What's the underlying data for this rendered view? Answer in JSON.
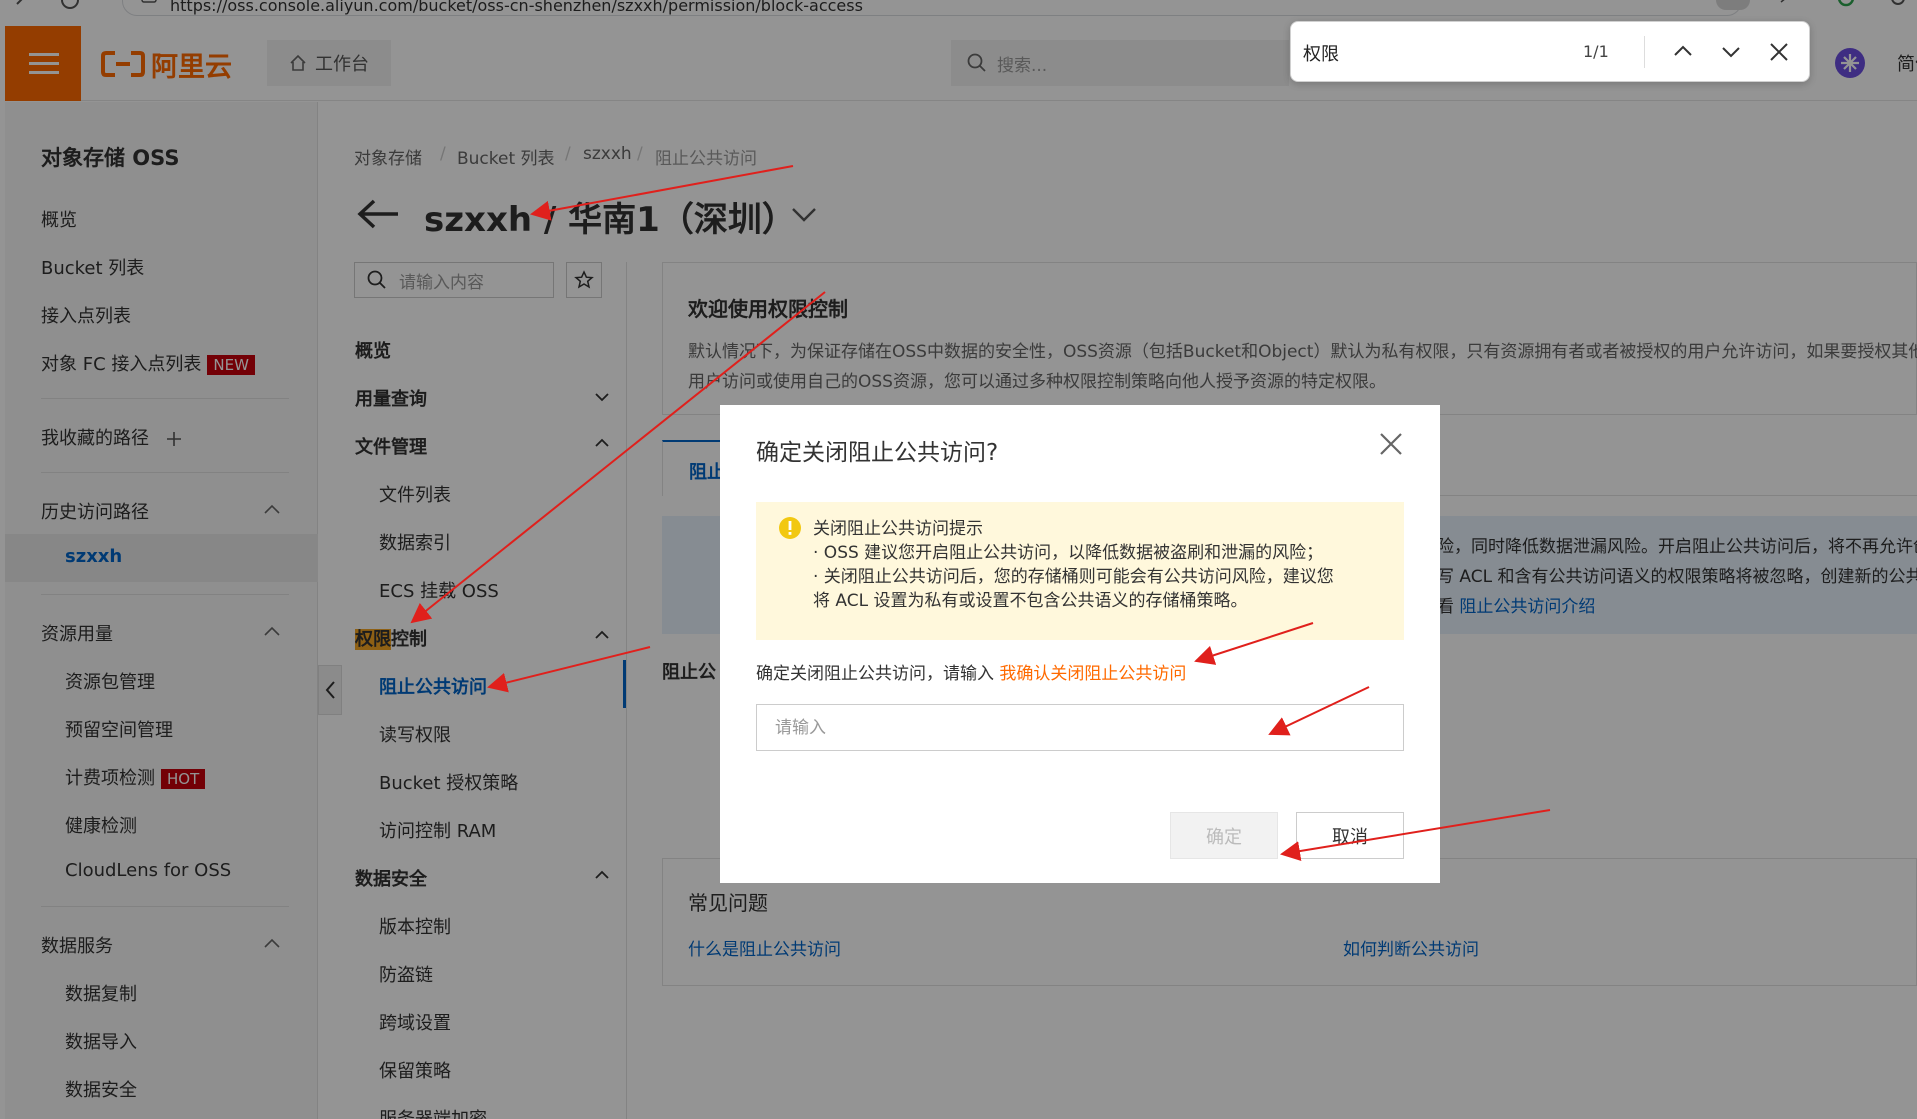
{
  "browser": {
    "url": "https://oss.console.aliyun.com/bucket/oss-cn-shenzhen/szxxh/permission/block-access"
  },
  "header": {
    "logo_text": "阿里云",
    "workbench_label": "工作台",
    "search_placeholder": "搜索...",
    "lang_label": "简体"
  },
  "find_bar": {
    "query": "权限",
    "count": "1/1"
  },
  "left_nav": {
    "title": "对象存储 OSS",
    "items": [
      {
        "label": "概览"
      },
      {
        "label": "Bucket 列表"
      },
      {
        "label": "接入点列表"
      },
      {
        "label": "对象 FC 接入点列表",
        "badge": "NEW"
      }
    ],
    "favorites_label": "我收藏的路径",
    "history": {
      "label": "历史访问路径",
      "items": [
        "szxxh"
      ]
    },
    "resources": {
      "label": "资源用量",
      "items": [
        "资源包管理",
        "预留空间管理",
        "计费项检测",
        "健康检测",
        "CloudLens for OSS"
      ],
      "hot_badge": "HOT"
    },
    "data_services": {
      "label": "数据服务",
      "items": [
        "数据复制",
        "数据导入",
        "数据安全"
      ]
    }
  },
  "breadcrumb": [
    "对象存储",
    "Bucket 列表",
    "szxxh",
    "阻止公共访问"
  ],
  "page_title": "szxxh / 华南1（深圳）",
  "second_nav": {
    "search_placeholder": "请输入内容",
    "items": {
      "overview": "概览",
      "usage_query": "用量查询",
      "file_mgmt": "文件管理",
      "file_list": "文件列表",
      "data_index": "数据索引",
      "ecs_mount": "ECS 挂载 OSS",
      "perm_highlight": "权限",
      "perm_rest": "控制",
      "block_public": "阻止公共访问",
      "rw_perm": "读写权限",
      "bucket_policy": "Bucket 授权策略",
      "ram": "访问控制 RAM",
      "data_security": "数据安全",
      "versioning": "版本控制",
      "hotlink": "防盗链",
      "cors": "跨域设置",
      "retention": "保留策略",
      "encryption": "服务器端加密"
    }
  },
  "welcome": {
    "title": "欢迎使用权限控制",
    "text1": "默认情况下，为保证存储在OSS中数据的安全性，OSS资源（包括Bucket和Object）默认为私有权限，只有资源拥有者或者被授权的用户允许访问，如果要授权其他",
    "text2": "用户访问或使用自己的OSS资源，您可以通过多种权限控制策略向他人授予资源的特定权限。"
  },
  "tab_label_partial": "阻止",
  "info_partial": {
    "line1": "险，同时降低数据泄漏风险。开启阻止公共访问后，将不再允许创",
    "line2": "写 ACL 和含有公共访问语义的权限策略将被忽略，创建新的公共",
    "line3_prefix": "看",
    "line3_link": "阻止公共访问介绍"
  },
  "section_label_partial": "阻止公",
  "faq": {
    "title": "常见问题",
    "link1": "什么是阻止公共访问",
    "link2": "如何判断公共访问"
  },
  "dialog": {
    "title": "确定关闭阻止公共访问?",
    "alert_title": "关闭阻止公共访问提示",
    "alert_line1": "· OSS 建议您开启阻止公共访问，以降低数据被盗刷和泄漏的风险；",
    "alert_line2": "· 关闭阻止公共访问后，您的存储桶则可能会有公共访问风险，建议您",
    "alert_line3": "将 ACL 设置为私有或设置不包含公共语义的存储桶策略。",
    "prompt_prefix": "确定关闭阻止公共访问，请输入",
    "confirm_phrase": "我确认关闭阻止公共访问",
    "input_placeholder": "请输入",
    "ok_label": "确定",
    "cancel_label": "取消"
  },
  "colors": {
    "brand": "#ff6a00",
    "link": "#0064c8",
    "annotation_arrow": "#e0201c",
    "new_badge": "#c7000b"
  }
}
